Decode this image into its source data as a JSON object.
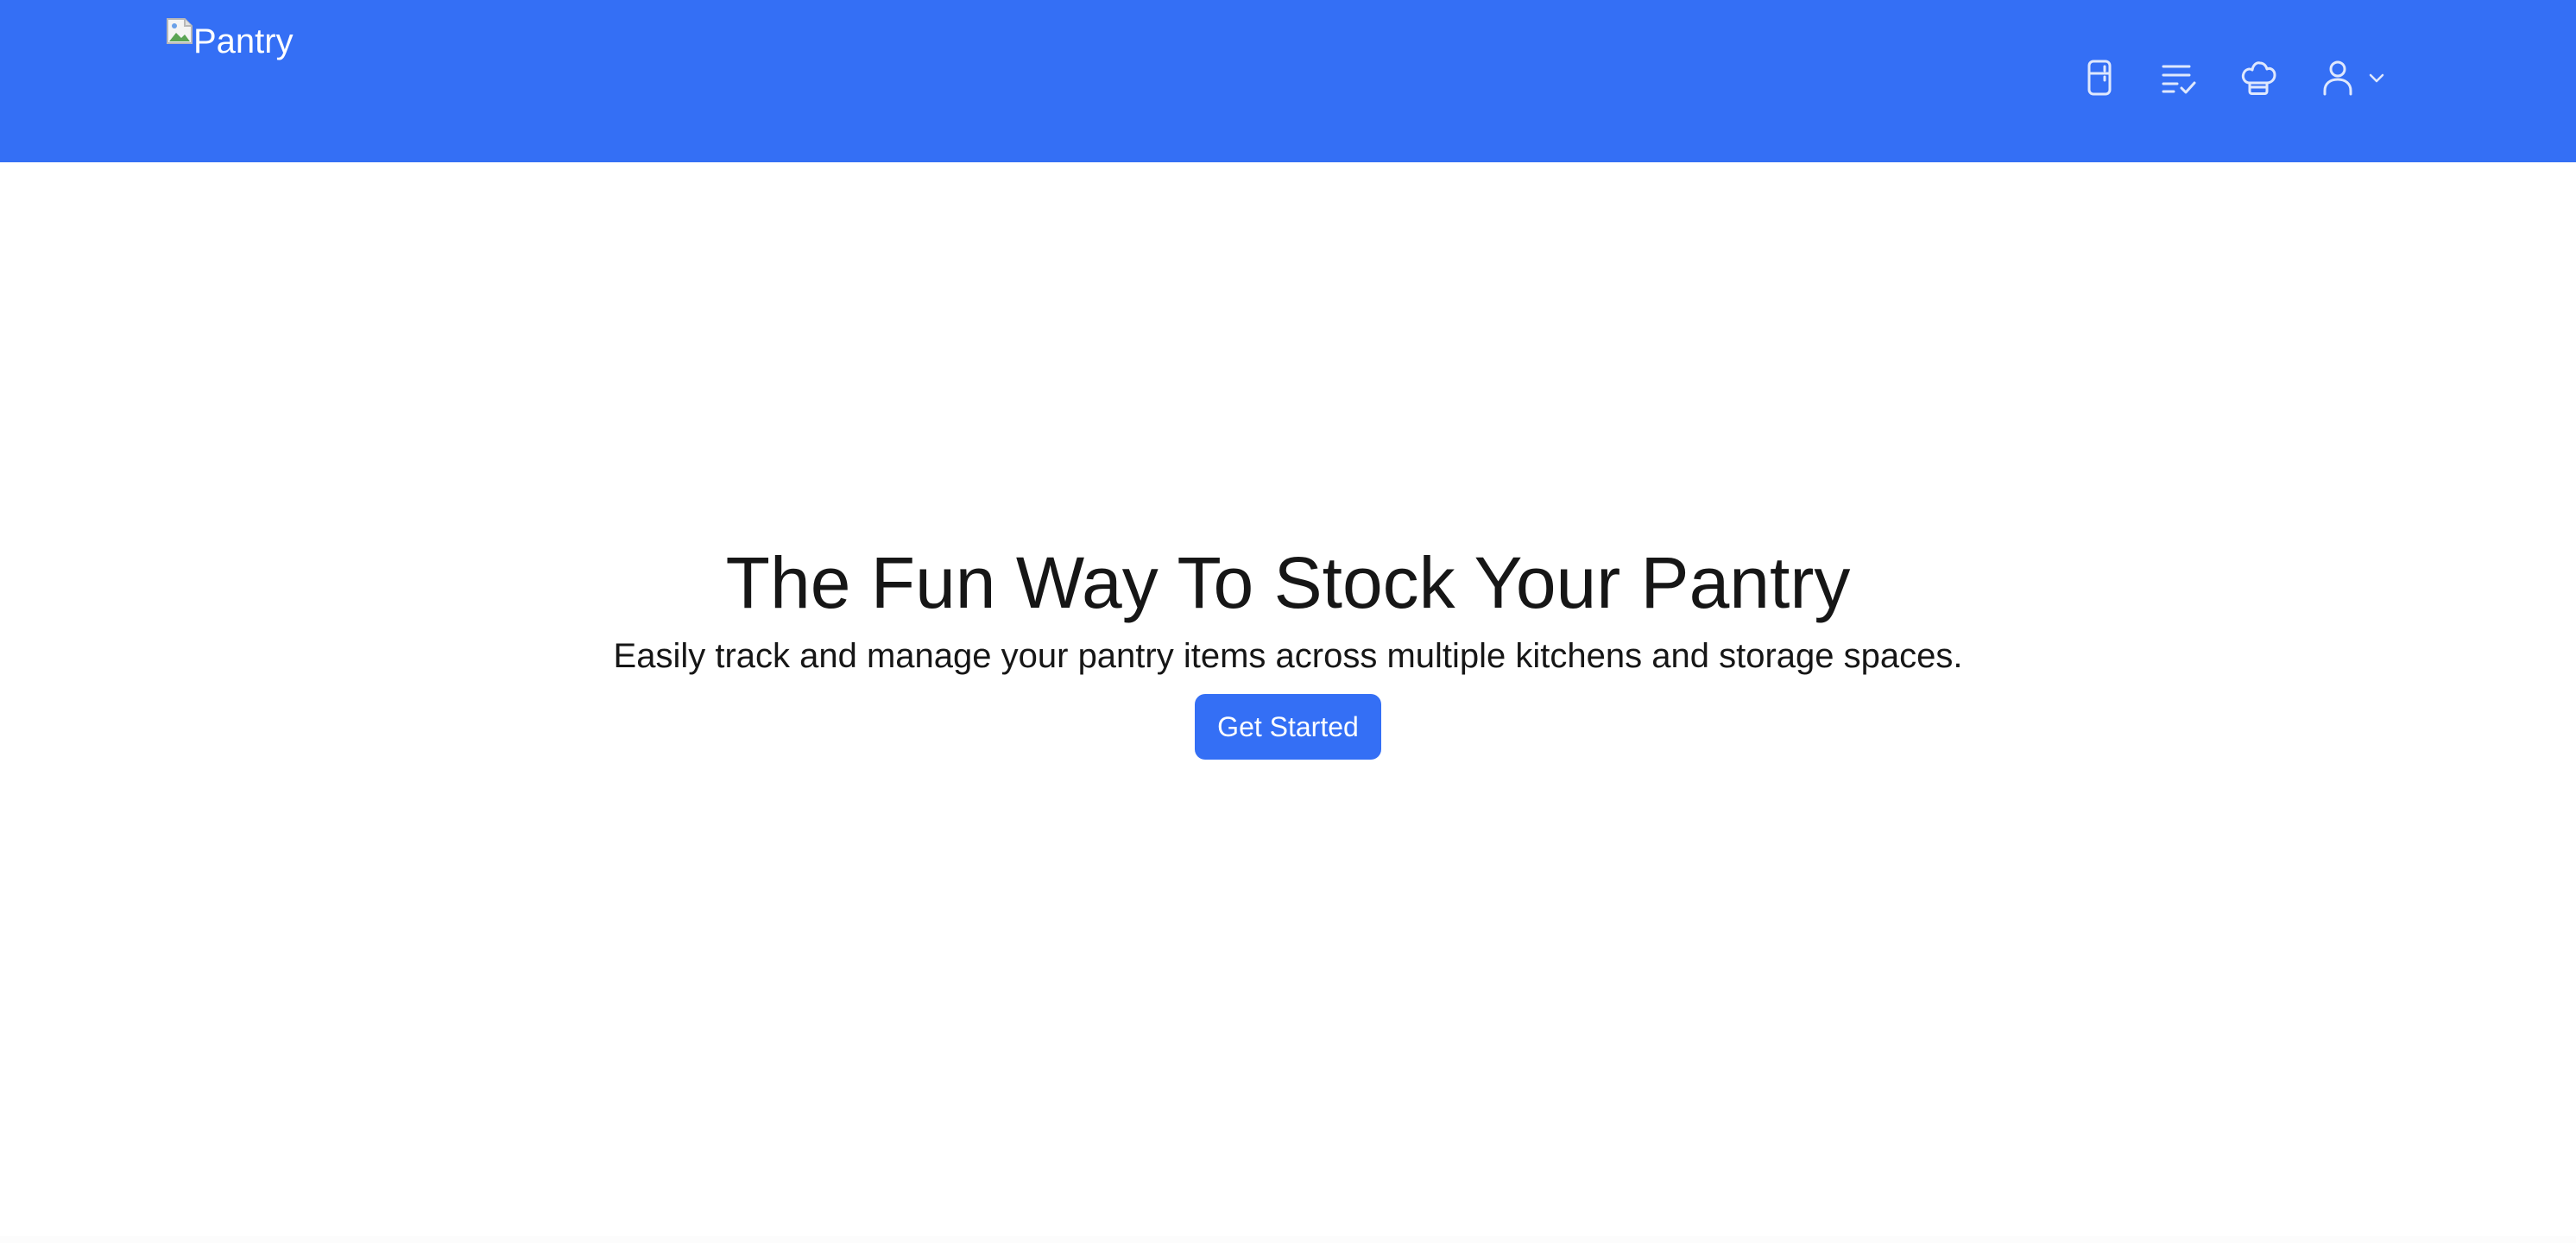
{
  "header": {
    "logo_alt": "Pantry",
    "background_color": "#346ff5",
    "nav_icons": [
      "fridge-icon",
      "checklist-icon",
      "chef-hat-icon",
      "user-icon",
      "chevron-down-icon"
    ]
  },
  "hero": {
    "title": "The Fun Way To Stock Your Pantry",
    "subtitle": "Easily track and manage your pantry items across multiple kitchens and storage spaces.",
    "cta_label": "Get Started",
    "cta_color": "#346ff5"
  }
}
